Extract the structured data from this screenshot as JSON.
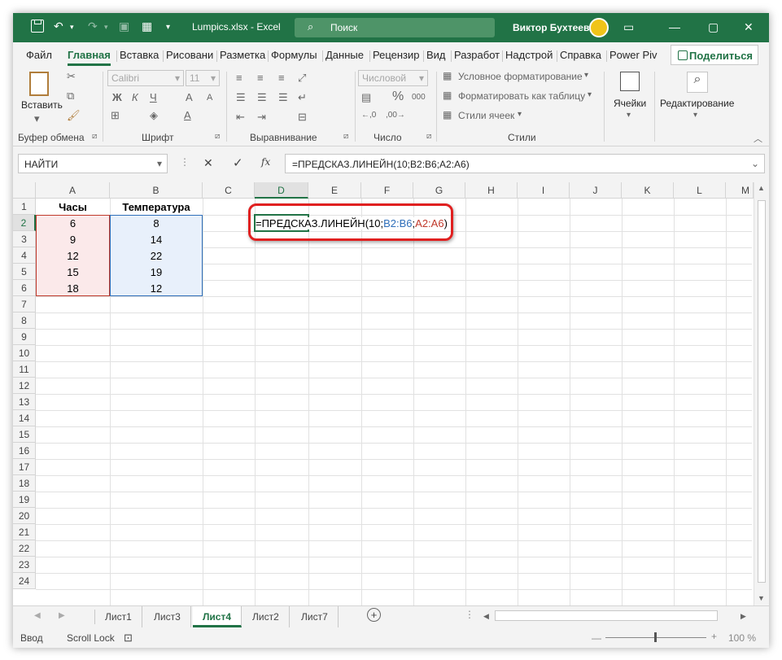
{
  "titlebar": {
    "file_title": "Lumpics.xlsx - Excel",
    "search_placeholder": "Поиск",
    "user_name": "Виктор Бухтеев"
  },
  "menu": {
    "tabs": [
      "Файл",
      "Главная",
      "Вставка",
      "Рисовани",
      "Разметка",
      "Формулы",
      "Данные",
      "Рецензир",
      "Вид",
      "Разработ",
      "Надстрой",
      "Справка",
      "Power Piv"
    ],
    "share_label": "Поделиться"
  },
  "ribbon": {
    "clipboard": {
      "paste_label": "Вставить",
      "group_label": "Буфер обмена"
    },
    "font": {
      "font_name": "Calibri",
      "font_size": "11",
      "group_label": "Шрифт"
    },
    "alignment": {
      "group_label": "Выравнивание"
    },
    "number": {
      "format": "Числовой",
      "group_label": "Число"
    },
    "styles": {
      "conditional": "Условное форматирование",
      "as_table": "Форматировать как таблицу",
      "cell_styles": "Стили ячеек",
      "group_label": "Стили"
    },
    "cells": {
      "label": "Ячейки"
    },
    "editing": {
      "label": "Редактирование"
    }
  },
  "formula_bar": {
    "name_box": "НАЙТИ",
    "formula": "=ПРЕДСКАЗ.ЛИНЕЙН(10;B2:B6;A2:A6)"
  },
  "sheet": {
    "columns": [
      "A",
      "B",
      "C",
      "D",
      "E",
      "F",
      "G",
      "H",
      "I",
      "J",
      "K",
      "L",
      "M"
    ],
    "rows": [
      "1",
      "2",
      "3",
      "4",
      "5",
      "6",
      "7",
      "8",
      "9",
      "10",
      "11",
      "12",
      "13",
      "14",
      "15",
      "16",
      "17",
      "18",
      "19",
      "20",
      "21",
      "22",
      "23",
      "24"
    ],
    "header_a": "Часы",
    "header_b": "Температура",
    "col_a": [
      "6",
      "9",
      "12",
      "15",
      "18"
    ],
    "col_b": [
      "8",
      "14",
      "22",
      "19",
      "12"
    ],
    "edit_prefix": "=ПРЕДСКАЗ.ЛИНЕЙН(10;",
    "edit_ref1": "B2:B6",
    "edit_sep": ";",
    "edit_ref2": "A2:A6",
    "edit_suffix": ")"
  },
  "sheet_tabs": [
    "Лист1",
    "Лист3",
    "Лист4",
    "Лист2",
    "Лист7"
  ],
  "status": {
    "mode": "Ввод",
    "scroll_lock": "Scroll Lock",
    "zoom": "100 %"
  },
  "colors": {
    "excel_green": "#217346",
    "ref_blue": "#2f6fba",
    "ref_red": "#c0392b",
    "highlight_red": "#e02020"
  }
}
